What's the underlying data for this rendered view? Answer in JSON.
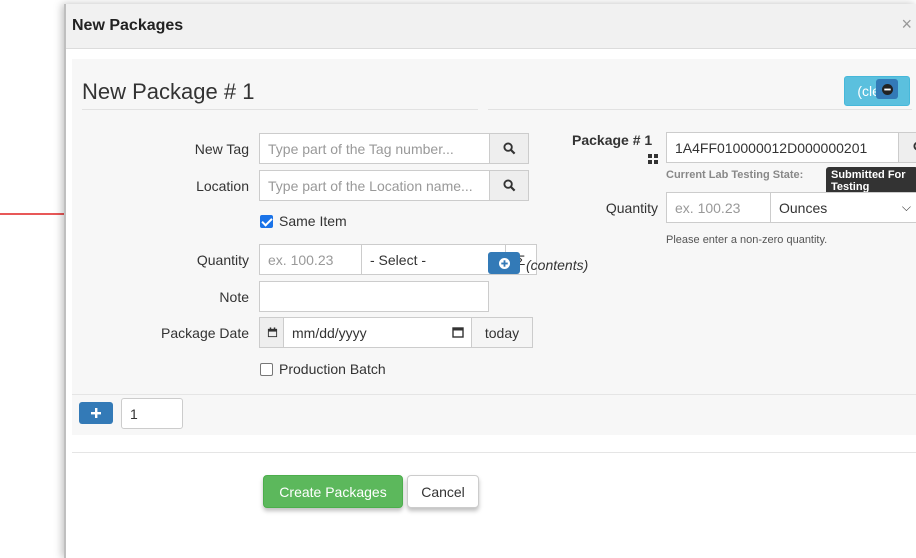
{
  "modal": {
    "title": "New Packages",
    "close_symbol": "×"
  },
  "package": {
    "title": "New Package # 1",
    "clear_label": "(clear)",
    "new_tag": {
      "label": "New Tag",
      "placeholder": "Type part of the Tag number..."
    },
    "location": {
      "label": "Location",
      "placeholder": "Type part of the Location name..."
    },
    "same_item": {
      "label": "Same Item",
      "checked": true
    },
    "quantity": {
      "label": "Quantity",
      "placeholder": "ex. 100.23",
      "unit": "- Select -",
      "sum_symbol": "Σ"
    },
    "note": {
      "label": "Note",
      "value": ""
    },
    "package_date": {
      "label": "Package Date",
      "placeholder": "mm/dd/yyyy",
      "today_label": "today"
    },
    "production_batch": {
      "label": "Production Batch",
      "checked": false
    },
    "contents_label": "(contents)",
    "count_value": "1"
  },
  "source": {
    "label": "Package # 1",
    "tag_value": "1A4FF010000012D000000201",
    "lab_state_label": "Current Lab Testing State:",
    "lab_state_value": "Submitted For Testing",
    "quantity_label": "Quantity",
    "quantity_placeholder": "ex. 100.23",
    "unit_value": "Ounces",
    "hint": "Please enter a non-zero quantity."
  },
  "footer": {
    "create_label": "Create Packages",
    "cancel_label": "Cancel"
  },
  "colors": {
    "info": "#5bc0de",
    "success": "#5cb85c",
    "primary": "#337ab7",
    "annotation_arrow": "#e02020"
  }
}
